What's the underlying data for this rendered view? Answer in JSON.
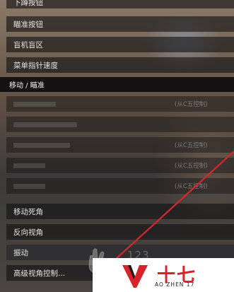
{
  "menu": {
    "top_items": [
      {
        "label": "下蹲按钮",
        "state": "clickable"
      },
      {
        "label": "瞄准按钮",
        "state": "clickable"
      },
      {
        "label": "盲机盲区",
        "state": "clickable"
      },
      {
        "label": "菜单指针速度",
        "state": "clickable"
      }
    ],
    "section_title": "移动 / 瞄准",
    "disabled_items": [
      {
        "label": "",
        "value": "(从C五控制)"
      },
      {
        "label": "",
        "value": ""
      },
      {
        "label": "",
        "value": "(从C五控制)"
      },
      {
        "label": "",
        "value": "(从C五控制)"
      },
      {
        "label": "",
        "value": "(从C五控制)"
      }
    ],
    "bottom_items": [
      {
        "label": "移动死角",
        "state": "clickable"
      },
      {
        "label": "反向视角",
        "state": "clickable"
      },
      {
        "label": "振动",
        "state": "selected"
      },
      {
        "label": "高级视角控制...",
        "state": "clickable"
      }
    ]
  },
  "watermark": {
    "brand": "十七",
    "sub": "AO ZHEN 17",
    "faded_number": "123",
    "color": "#d8232a"
  },
  "icons": {
    "laser": "laser-line",
    "logo": "v-logo-icon",
    "cursor": "cursor-icon"
  }
}
